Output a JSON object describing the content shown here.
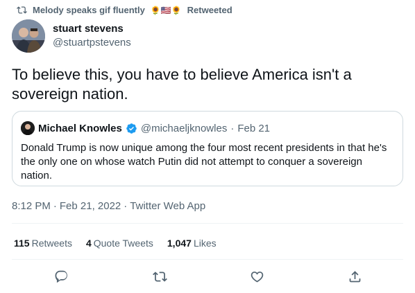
{
  "retweet_banner": {
    "user": "Melody speaks gif fluently",
    "emojis": "🌻🇺🇸🌻",
    "label": "Retweeted"
  },
  "author": {
    "name": "stuart stevens",
    "handle": "@stuartpstevens"
  },
  "tweet_text": "To believe this, you have to believe America isn't a sovereign nation.",
  "quoted_tweet": {
    "name": "Michael Knowles",
    "handle": "@michaeljknowles",
    "separator": "·",
    "date": "Feb 21",
    "text": "Donald Trump is now unique among the four most recent presidents in that he's the only one on whose watch Putin did not attempt to conquer a sovereign nation."
  },
  "meta": {
    "time": "8:12 PM",
    "separator1": "·",
    "date": "Feb 21, 2022",
    "separator2": "·",
    "source": "Twitter Web App"
  },
  "stats": {
    "retweets_count": "115",
    "retweets_label": "Retweets",
    "quotes_count": "4",
    "quotes_label": "Quote Tweets",
    "likes_count": "1,047",
    "likes_label": "Likes"
  },
  "actions": [
    "reply-icon",
    "retweet-icon",
    "like-icon",
    "share-icon"
  ],
  "colors": {
    "text": "#0f1419",
    "secondary": "#536471",
    "border": "#cfd9de",
    "verified": "#1d9bf0"
  }
}
